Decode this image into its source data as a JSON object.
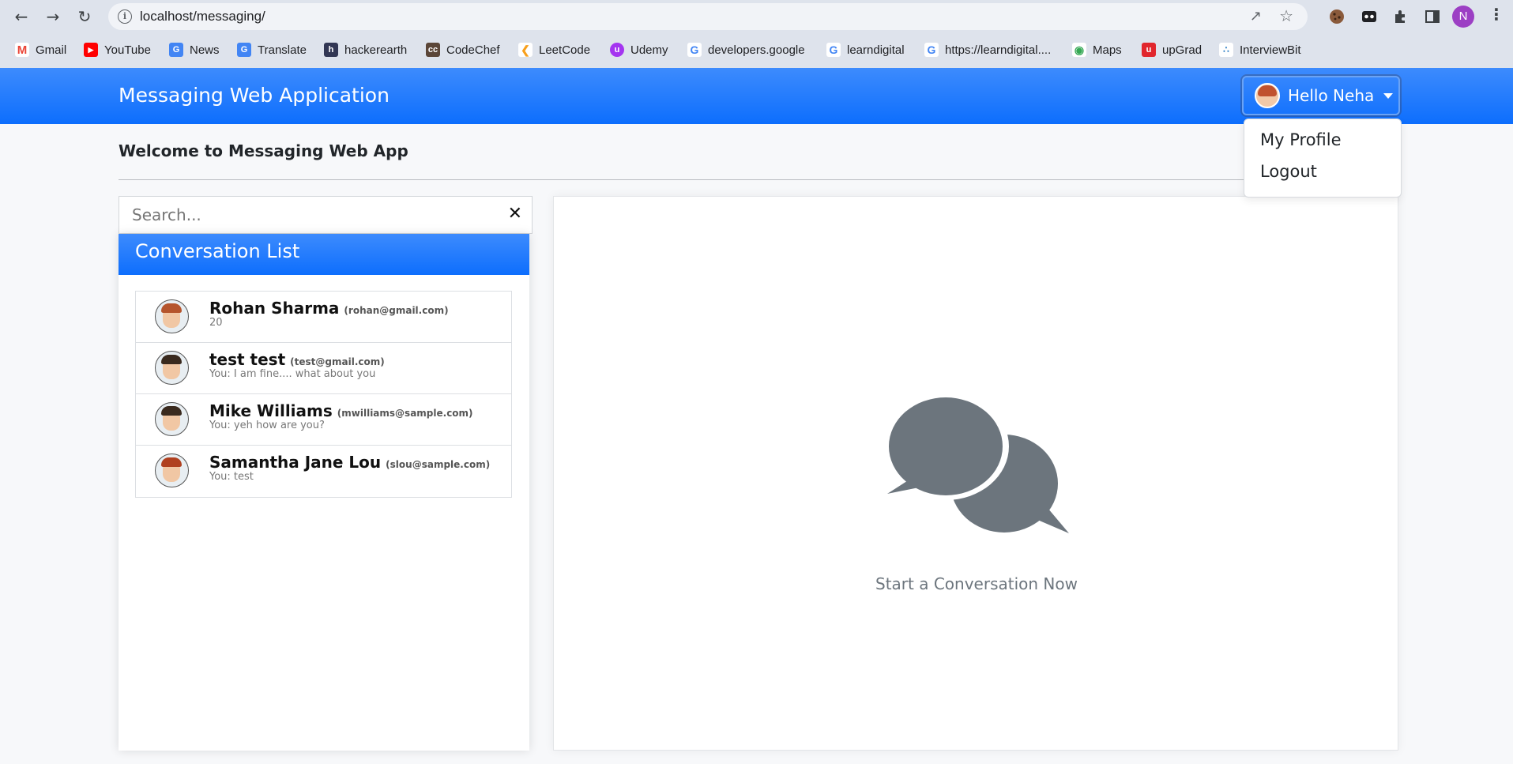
{
  "browser": {
    "url": "localhost/messaging/",
    "profile_initial": "N",
    "bookmarks": [
      {
        "label": "Gmail",
        "icon": "gmail-icon",
        "color": "#ea4335"
      },
      {
        "label": "YouTube",
        "icon": "youtube-icon",
        "color": "#ff0000"
      },
      {
        "label": "News",
        "icon": "news-icon",
        "color": "#4285f4"
      },
      {
        "label": "Translate",
        "icon": "translate-icon",
        "color": "#4285f4"
      },
      {
        "label": "hackerearth",
        "icon": "hackerearth-icon",
        "color": "#323754"
      },
      {
        "label": "CodeChef",
        "icon": "codechef-icon",
        "color": "#5b4638"
      },
      {
        "label": "LeetCode",
        "icon": "leetcode-icon",
        "color": "#f89f1b"
      },
      {
        "label": "Udemy",
        "icon": "udemy-icon",
        "color": "#a435f0"
      },
      {
        "label": "developers.google",
        "icon": "google-icon",
        "color": "#4285f4"
      },
      {
        "label": "learndigital",
        "icon": "google-icon",
        "color": "#4285f4"
      },
      {
        "label": "https://learndigital....",
        "icon": "google-icon",
        "color": "#4285f4"
      },
      {
        "label": "Maps",
        "icon": "maps-icon",
        "color": "#34a853"
      },
      {
        "label": "upGrad",
        "icon": "upgrad-icon",
        "color": "#e1262d"
      },
      {
        "label": "InterviewBit",
        "icon": "interviewbit-icon",
        "color": "#2b7dc4"
      }
    ]
  },
  "navbar": {
    "brand": "Messaging Web Application",
    "user_greeting": "Hello Neha"
  },
  "dropdown": {
    "items": [
      "My Profile",
      "Logout"
    ]
  },
  "main": {
    "welcome": "Welcome to Messaging Web App",
    "search_placeholder": "Search...",
    "clear_symbol": "✕",
    "conversation_header": "Conversation List",
    "conversations": [
      {
        "name": "Rohan Sharma",
        "email": "(rohan@gmail.com)",
        "last_message": "20",
        "hair": "#b5542c"
      },
      {
        "name": "test test",
        "email": "(test@gmail.com)",
        "last_message": "You: I am fine.... what about you",
        "hair": "#3a2a1e"
      },
      {
        "name": "Mike Williams",
        "email": "(mwilliams@sample.com)",
        "last_message": "You: yeh how are you?",
        "hair": "#3a2a1e"
      },
      {
        "name": "Samantha Jane Lou",
        "email": "(slou@sample.com)",
        "last_message": "You: test",
        "hair": "#b0401f"
      }
    ],
    "empty_state_text": "Start a Conversation Now"
  },
  "colors": {
    "primary": "#0d6efd",
    "icon_gray": "#6c757d"
  }
}
